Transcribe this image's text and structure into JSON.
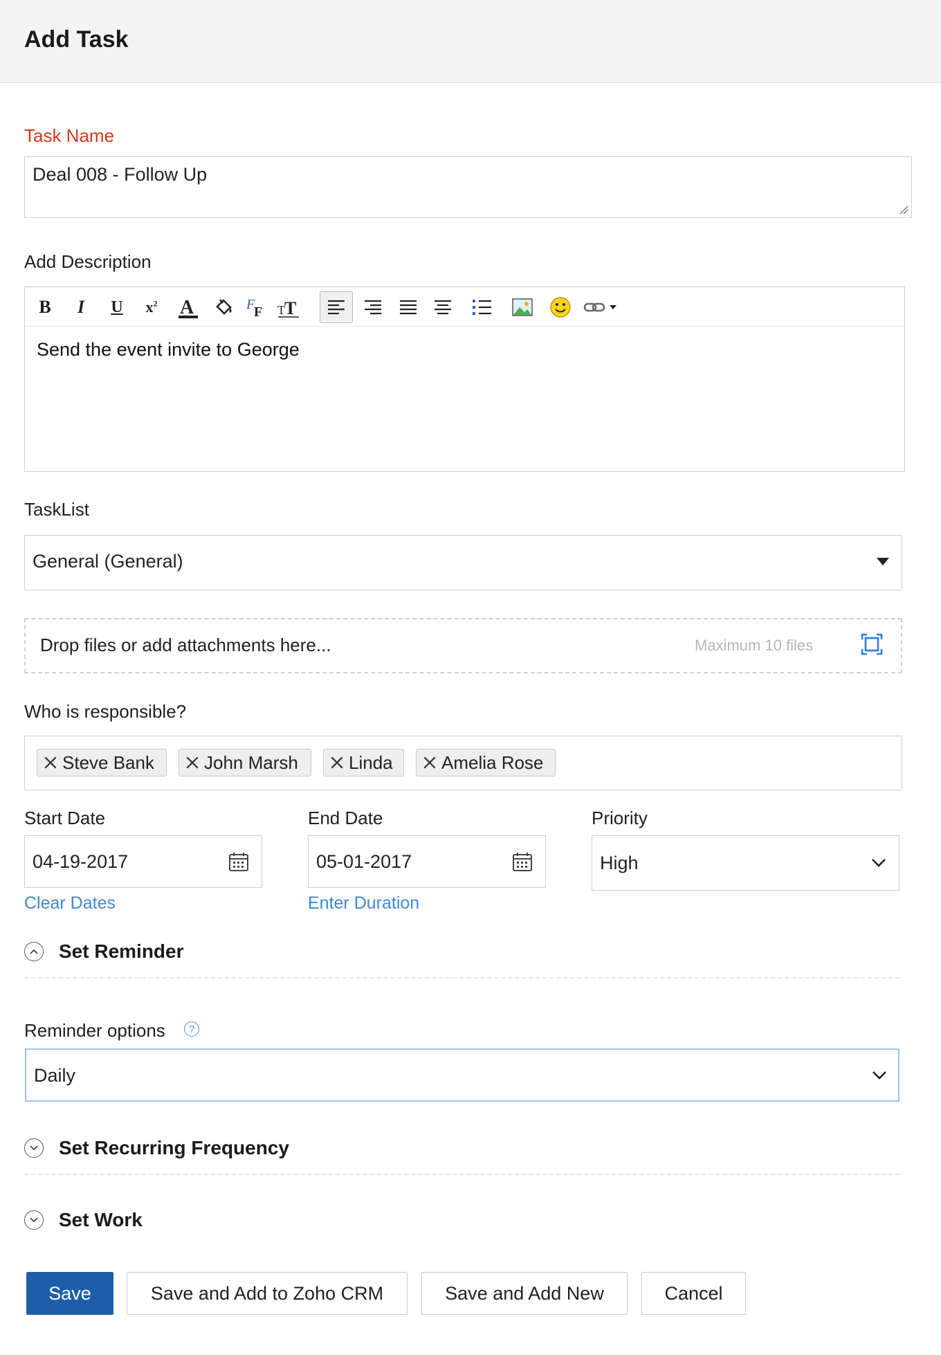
{
  "header": {
    "title": "Add Task"
  },
  "task_name": {
    "label": "Task Name",
    "value": "Deal 008 - Follow Up"
  },
  "description": {
    "label": "Add Description",
    "value": "Send the event invite to George",
    "toolbar": [
      "bold-icon",
      "italic-icon",
      "underline-icon",
      "superscript-icon",
      "font-color-icon",
      "fill-color-icon",
      "font-family-icon",
      "font-size-icon",
      "align-left-icon",
      "align-right-icon",
      "justify-icon",
      "align-center-icon",
      "bullet-list-icon",
      "insert-image-icon",
      "emoji-icon",
      "insert-link-icon",
      "more-dropdown-icon"
    ]
  },
  "tasklist": {
    "label": "TaskList",
    "value": "General (General)"
  },
  "attachments": {
    "text": "Drop files or add attachments here...",
    "hint": "Maximum 10 files"
  },
  "responsible": {
    "label": "Who is responsible?",
    "people": [
      "Steve Bank",
      "John Marsh",
      "Linda",
      "Amelia Rose"
    ]
  },
  "start_date": {
    "label": "Start Date",
    "value": "04-19-2017",
    "link": "Clear Dates"
  },
  "end_date": {
    "label": "End Date",
    "value": "05-01-2017",
    "link": "Enter Duration"
  },
  "priority": {
    "label": "Priority",
    "value": "High"
  },
  "reminder_section": {
    "title": "Set Reminder"
  },
  "reminder_options": {
    "label": "Reminder options",
    "value": "Daily"
  },
  "recurring_section": {
    "title": "Set Recurring Frequency"
  },
  "work_section": {
    "title": "Set Work"
  },
  "buttons": {
    "save": "Save",
    "save_crm": "Save and Add to Zoho CRM",
    "save_new": "Save and Add New",
    "cancel": "Cancel"
  },
  "colors": {
    "required_label": "#d23a20",
    "link": "#3d87d9",
    "primary_button": "#1e5da8",
    "focus_border": "#9cc3e8"
  }
}
